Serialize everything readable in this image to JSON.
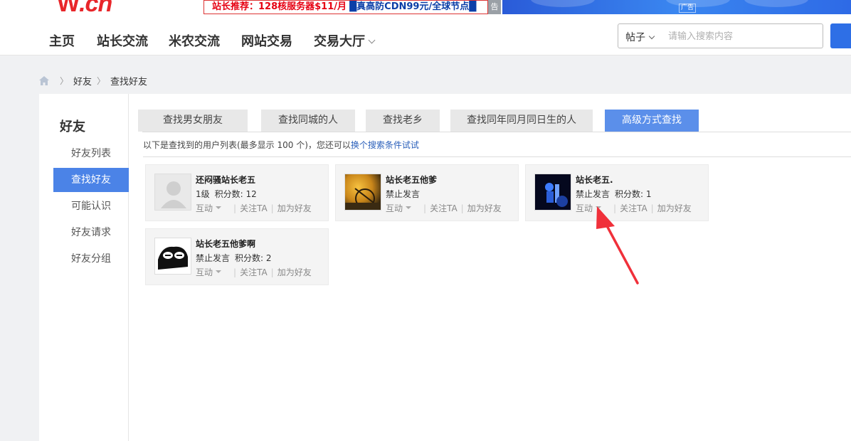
{
  "banner": {
    "logo_main": "W",
    "logo_suffix": ".cn",
    "ad_text_red": "站长推荐：128核服务器$11/月",
    "ad_text_blue": "█真高防CDN99元/全球节点█",
    "ad_tag": "告",
    "ad2_tag": "广告"
  },
  "nav": {
    "items": [
      "主页",
      "站长交流",
      "米农交流",
      "网站交易",
      "交易大厅"
    ],
    "search_category": "帖子",
    "search_placeholder": "请输入搜索内容"
  },
  "breadcrumb": [
    "好友",
    "查找好友"
  ],
  "sidebar": {
    "title": "好友",
    "items": [
      "好友列表",
      "查找好友",
      "可能认识",
      "好友请求",
      "好友分组"
    ],
    "active_index": 1
  },
  "tabs": [
    "查找男女朋友",
    "查找同城的人",
    "查找老乡",
    "查找同年同月同日生的人",
    "高级方式查找"
  ],
  "active_tab": 4,
  "info": {
    "text": "以下是查找到的用户列表(最多显示 100 个)，您还可以",
    "link": "换个搜索条件试试"
  },
  "users": [
    {
      "name": "还闷骚站长老五",
      "level": "1级",
      "score": "积分数: 12",
      "action1": "互动",
      "action2": "关注TA",
      "action3": "加为好友",
      "avatar": "default-avatar"
    },
    {
      "name": "站长老五他爹",
      "level": "禁止发言",
      "score": "",
      "action1": "互动",
      "action2": "关注TA",
      "action3": "加为好友",
      "avatar": "bicycle-photo"
    },
    {
      "name": "站长老五.",
      "level": "禁止发言",
      "score": "积分数: 1",
      "action1": "互动",
      "action2": "关注TA",
      "action3": "加为好友",
      "avatar": "dark-blue-figure"
    },
    {
      "name": "站长老五他爹啊",
      "level": "禁止发言",
      "score": "积分数: 2",
      "action1": "互动",
      "action2": "关注TA",
      "action3": "加为好友",
      "avatar": "panda-meme"
    }
  ],
  "colors": {
    "accent": "#4b83e7",
    "tab_active": "#5b8fea",
    "link": "#2a5fba",
    "arrow": "#f0303a"
  }
}
